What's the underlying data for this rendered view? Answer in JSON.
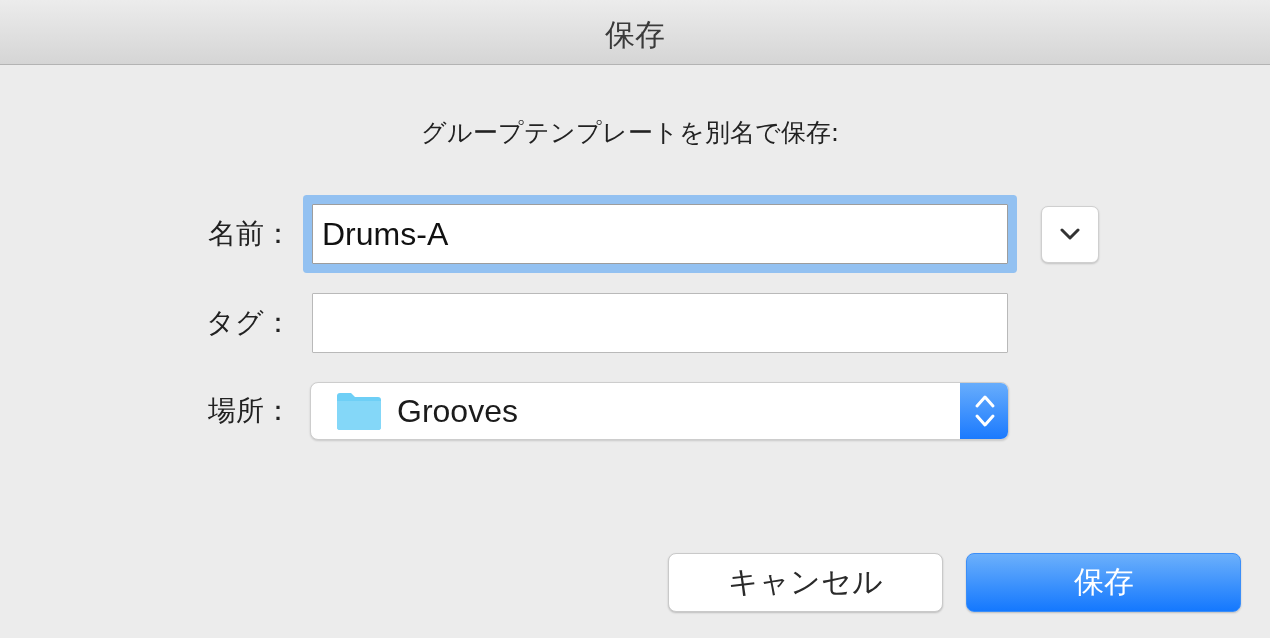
{
  "window": {
    "title": "保存"
  },
  "prompt": "グループテンプレートを別名で保存:",
  "fields": [
    {
      "kind": "text",
      "label": "名前：",
      "value": "Drums-A",
      "focused": true,
      "expanded": false
    },
    {
      "kind": "text",
      "label": "タグ：",
      "focused": false
    },
    {
      "kind": "popup",
      "label": "場所：",
      "value": "Grooves"
    }
  ],
  "buttons": [
    {
      "label": "キャンセル",
      "default": false
    },
    {
      "label": "保存",
      "default": true
    }
  ]
}
